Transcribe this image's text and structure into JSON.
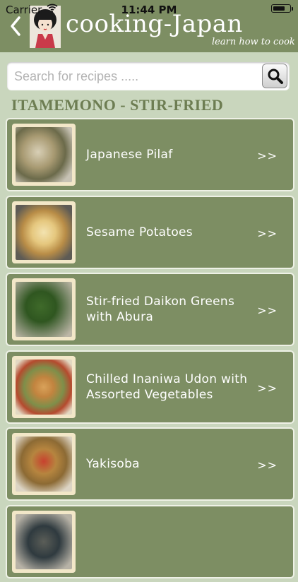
{
  "status": {
    "carrier": "Carrier",
    "time": "11:44 PM"
  },
  "header": {
    "brand": "cooking-Japan",
    "tagline": "learn how to cook"
  },
  "search": {
    "placeholder": "Search for recipes ....."
  },
  "section": {
    "title": "ITAMEMONO - STIR-FRIED"
  },
  "recipes": [
    {
      "title": "Japanese Pilaf",
      "chevron": ">>"
    },
    {
      "title": "Sesame Potatoes",
      "chevron": ">>"
    },
    {
      "title": "Stir-fried Daikon Greens with Abura",
      "chevron": ">>"
    },
    {
      "title": "Chilled Inaniwa Udon with Assorted Vegetables",
      "chevron": ">>"
    },
    {
      "title": "Yakisoba",
      "chevron": ">>"
    },
    {
      "title": "",
      "chevron": ""
    }
  ],
  "colors": {
    "header": "#7d8e63",
    "background": "#c9d6bd",
    "row": "#7d8e63",
    "section_title": "#6d7d52"
  }
}
